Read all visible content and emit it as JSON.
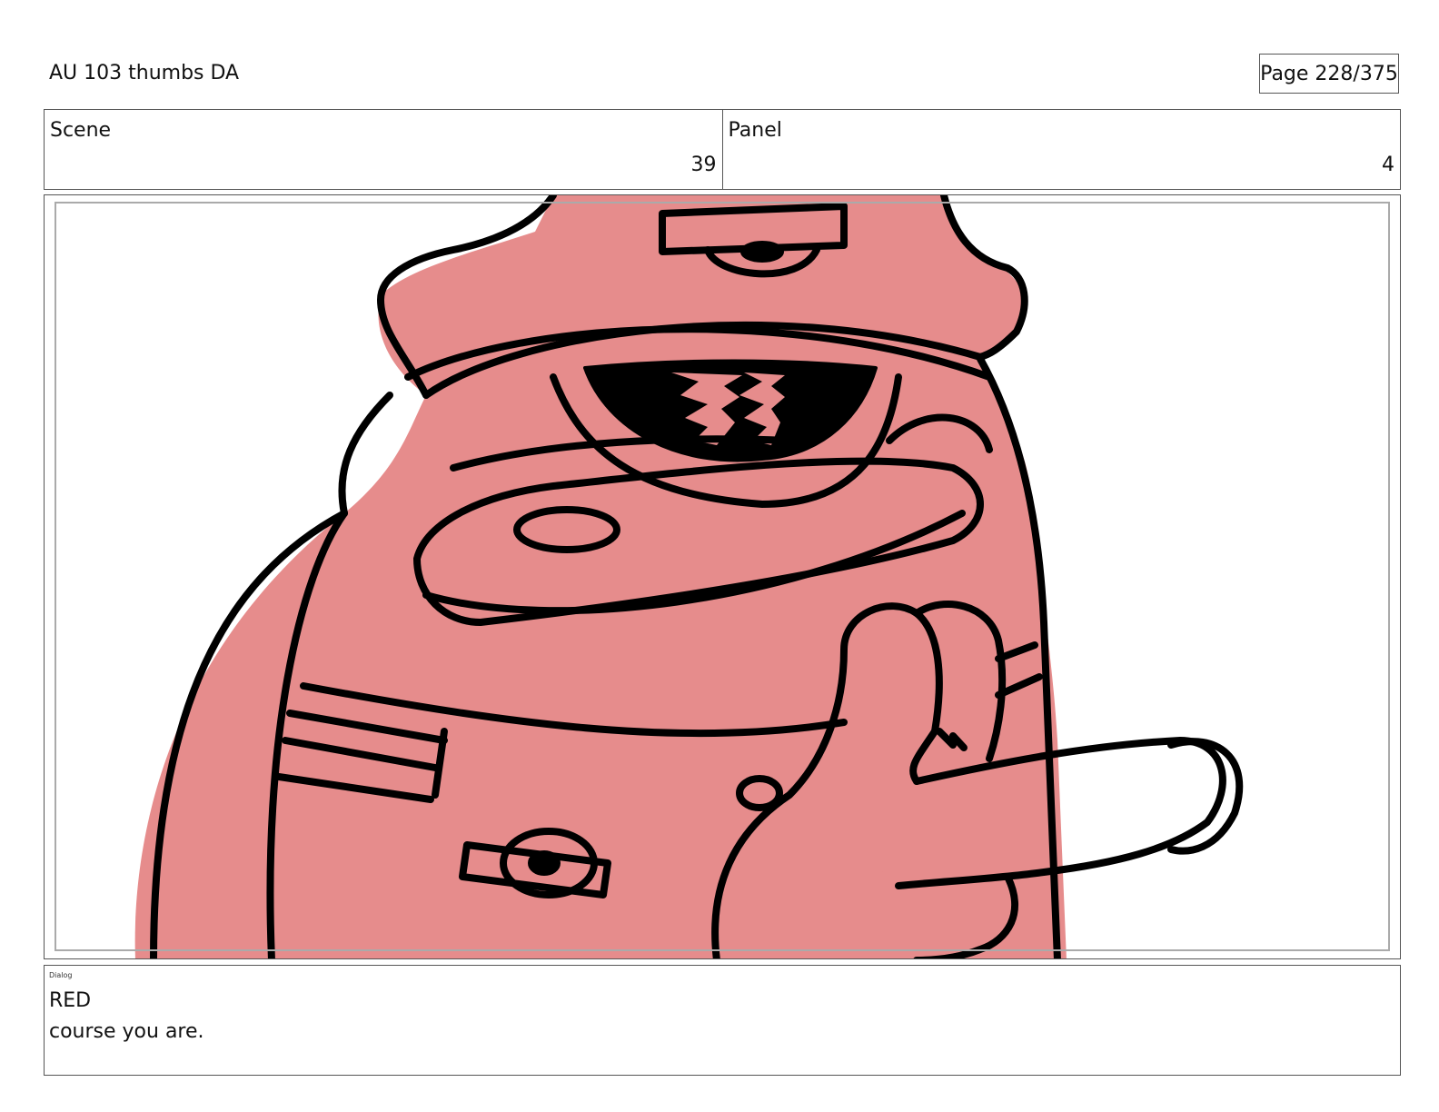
{
  "header": {
    "title": "AU 103 thumbs DA",
    "page": "Page 228/375"
  },
  "info": {
    "scene_label": "Scene",
    "scene_value": "39",
    "panel_label": "Panel",
    "panel_value": "4"
  },
  "panel": {
    "fill_color": "#e68c8c",
    "line_color": "#000000"
  },
  "dialog": {
    "label": "Dialog",
    "speaker": "RED",
    "line": "course you are."
  }
}
